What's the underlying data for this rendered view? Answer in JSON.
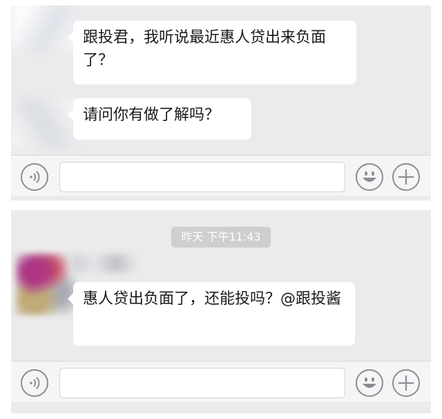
{
  "chat1": {
    "messages": [
      {
        "text": "跟投君，我听说最近惠人贷出来负面了？"
      },
      {
        "text": "请问你有做了解吗？"
      }
    ]
  },
  "chat2": {
    "timestamp": "昨天 下午11:43",
    "messages": [
      {
        "text": "惠人贷出负面了，还能投吗？@跟投酱"
      }
    ]
  },
  "icons": {
    "voice": "voice-icon",
    "emoji": "emoji-icon",
    "plus": "plus-icon"
  },
  "colors": {
    "chat_background": "#ebebeb",
    "bubble": "#ffffff",
    "input_bar": "#f5f5f7",
    "icon_stroke": "#8c8c90"
  }
}
